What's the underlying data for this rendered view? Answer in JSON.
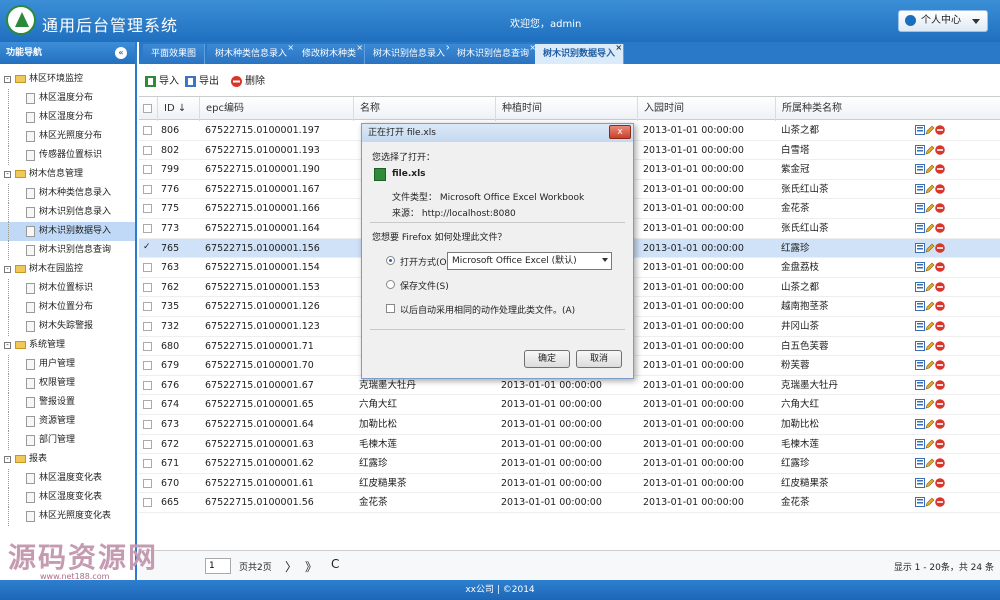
{
  "app": {
    "title": "通用后台管理系统",
    "welcome": "欢迎您，admin",
    "user_menu": "个人中心"
  },
  "sidebar": {
    "title": "功能导航",
    "collapse_glyph": "«",
    "nodes": [
      {
        "label": "林区环境监控",
        "level": 0
      },
      {
        "label": "林区温度分布",
        "level": 1
      },
      {
        "label": "林区湿度分布",
        "level": 1
      },
      {
        "label": "林区光照度分布",
        "level": 1
      },
      {
        "label": "传感器位置标识",
        "level": 1
      },
      {
        "label": "树木信息管理",
        "level": 0
      },
      {
        "label": "树木种类信息录入",
        "level": 1
      },
      {
        "label": "树木识别信息录入",
        "level": 1
      },
      {
        "label": "树木识别数据导入",
        "level": 1,
        "selected": true
      },
      {
        "label": "树木识别信息查询",
        "level": 1
      },
      {
        "label": "树木在园监控",
        "level": 0
      },
      {
        "label": "树木位置标识",
        "level": 1
      },
      {
        "label": "树木位置分布",
        "level": 1
      },
      {
        "label": "树木失踪警报",
        "level": 1
      },
      {
        "label": "系统管理",
        "level": 0
      },
      {
        "label": "用户管理",
        "level": 1
      },
      {
        "label": "权限管理",
        "level": 1
      },
      {
        "label": "警报设置",
        "level": 1
      },
      {
        "label": "资源管理",
        "level": 1
      },
      {
        "label": "部门管理",
        "level": 1
      },
      {
        "label": "报表",
        "level": 0
      },
      {
        "label": "林区温度变化表",
        "level": 1
      },
      {
        "label": "林区湿度变化表",
        "level": 1
      },
      {
        "label": "林区光照度变化表",
        "level": 1
      }
    ]
  },
  "tabs": [
    {
      "label": "平面效果图",
      "closable": false
    },
    {
      "label": "树木种类信息录入",
      "closable": true
    },
    {
      "label": "修改树木种类",
      "closable": true
    },
    {
      "label": "树木识别信息录入",
      "closable": true
    },
    {
      "label": "树木识别信息查询",
      "closable": true
    },
    {
      "label": "树木识别数据导入",
      "closable": true,
      "active": true
    }
  ],
  "toolbar": {
    "import": "导入",
    "export": "导出",
    "delete": "删除"
  },
  "table": {
    "columns": [
      "ID ↓",
      "epc编码",
      "名称",
      "种植时间",
      "入园时间",
      "所属种类名称"
    ],
    "rows": [
      {
        "id": "806",
        "epc": "67522715.0100001.197",
        "name": "",
        "plant": "",
        "enter": "2013-01-01 00:00:00",
        "species": "山茶之都"
      },
      {
        "id": "802",
        "epc": "67522715.0100001.193",
        "name": "",
        "plant": "",
        "enter": "2013-01-01 00:00:00",
        "species": "白雪塔"
      },
      {
        "id": "799",
        "epc": "67522715.0100001.190",
        "name": "",
        "plant": "",
        "enter": "2013-01-01 00:00:00",
        "species": "紫金冠"
      },
      {
        "id": "776",
        "epc": "67522715.0100001.167",
        "name": "",
        "plant": "",
        "enter": "2013-01-01 00:00:00",
        "species": "张氏红山茶"
      },
      {
        "id": "775",
        "epc": "67522715.0100001.166",
        "name": "",
        "plant": "",
        "enter": "2013-01-01 00:00:00",
        "species": "金花茶"
      },
      {
        "id": "773",
        "epc": "67522715.0100001.164",
        "name": "",
        "plant": "",
        "enter": "2013-01-01 00:00:00",
        "species": "张氏红山茶"
      },
      {
        "id": "765",
        "epc": "67522715.0100001.156",
        "name": "",
        "plant": "",
        "enter": "2013-01-01 00:00:00",
        "species": "红露珍",
        "selected": true
      },
      {
        "id": "763",
        "epc": "67522715.0100001.154",
        "name": "",
        "plant": "",
        "enter": "2013-01-01 00:00:00",
        "species": "金盘荔枝"
      },
      {
        "id": "762",
        "epc": "67522715.0100001.153",
        "name": "",
        "plant": "",
        "enter": "2013-01-01 00:00:00",
        "species": "山茶之都"
      },
      {
        "id": "735",
        "epc": "67522715.0100001.126",
        "name": "",
        "plant": "",
        "enter": "2013-01-01 00:00:00",
        "species": "越南抱茎茶"
      },
      {
        "id": "732",
        "epc": "67522715.0100001.123",
        "name": "",
        "plant": "",
        "enter": "2013-01-01 00:00:00",
        "species": "井冈山茶"
      },
      {
        "id": "680",
        "epc": "67522715.0100001.71",
        "name": "",
        "plant": "",
        "enter": "2013-01-01 00:00:00",
        "species": "白五色芙蓉"
      },
      {
        "id": "679",
        "epc": "67522715.0100001.70",
        "name": "",
        "plant": "",
        "enter": "2013-01-01 00:00:00",
        "species": "粉芙蓉"
      },
      {
        "id": "676",
        "epc": "67522715.0100001.67",
        "name": "克瑞墨大牡丹",
        "plant": "2013-01-01 00:00:00",
        "enter": "2013-01-01 00:00:00",
        "species": "克瑞墨大牡丹"
      },
      {
        "id": "674",
        "epc": "67522715.0100001.65",
        "name": "六角大红",
        "plant": "2013-01-01 00:00:00",
        "enter": "2013-01-01 00:00:00",
        "species": "六角大红"
      },
      {
        "id": "673",
        "epc": "67522715.0100001.64",
        "name": "加勒比松",
        "plant": "2013-01-01 00:00:00",
        "enter": "2013-01-01 00:00:00",
        "species": "加勒比松"
      },
      {
        "id": "672",
        "epc": "67522715.0100001.63",
        "name": "毛楝木莲",
        "plant": "2013-01-01 00:00:00",
        "enter": "2013-01-01 00:00:00",
        "species": "毛楝木莲"
      },
      {
        "id": "671",
        "epc": "67522715.0100001.62",
        "name": "红露珍",
        "plant": "2013-01-01 00:00:00",
        "enter": "2013-01-01 00:00:00",
        "species": "红露珍"
      },
      {
        "id": "670",
        "epc": "67522715.0100001.61",
        "name": "红皮糙果茶",
        "plant": "2013-01-01 00:00:00",
        "enter": "2013-01-01 00:00:00",
        "species": "红皮糙果茶"
      },
      {
        "id": "665",
        "epc": "67522715.0100001.56",
        "name": "金花茶",
        "plant": "2013-01-01 00:00:00",
        "enter": "2013-01-01 00:00:00",
        "species": "金花茶"
      }
    ]
  },
  "pager": {
    "page_value": "1",
    "total_pages": "页共2页",
    "next": "〉",
    "last": "》",
    "refresh": "C",
    "summary": "显示 1 - 20条，共 24 条"
  },
  "footer": "xx公司 | ©2014",
  "dialog": {
    "title": "正在打开 file.xls",
    "close": "x",
    "chosen": "您选择了打开：",
    "filename": "file.xls",
    "filetype": "文件类型：  Microsoft Office Excel Workbook",
    "source": "来源：  http://localhost:8080",
    "question": "您想要 Firefox 如何处理此文件？",
    "open_with": "打开方式(O)",
    "open_with_value": "Microsoft Office Excel (默认)",
    "save_file": "保存文件(S)",
    "remember": "以后自动采用相同的动作处理此类文件。(A)",
    "ok": "确定",
    "cancel": "取消"
  },
  "watermark": {
    "title": "源码资源网",
    "url": "www.net188.com"
  },
  "colors": {
    "header_blue": "#2370bf",
    "selected_row": "#cfe2f7",
    "delete_red": "#d9362b"
  }
}
